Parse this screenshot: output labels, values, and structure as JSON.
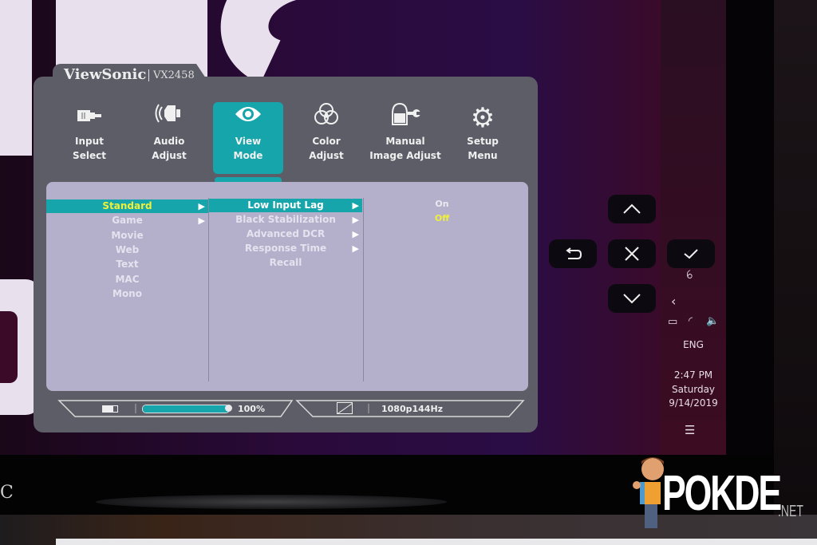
{
  "osd": {
    "brand": "ViewSonic",
    "model": "VX2458",
    "accent_color": "#17a5ac",
    "selected_text_color": "#f0f038",
    "menu": [
      {
        "line1": "Input",
        "line2": "Select",
        "icon": "input-connector-icon",
        "glyph": "▬"
      },
      {
        "line1": "Audio",
        "line2": "Adjust",
        "icon": "speaker-icon",
        "glyph": "🔊"
      },
      {
        "line1": "View",
        "line2": "Mode",
        "icon": "eye-icon",
        "glyph": "◉",
        "active": true
      },
      {
        "line1": "Color",
        "line2": "Adjust",
        "icon": "color-circles-icon",
        "glyph": "❀"
      },
      {
        "line1": "Manual",
        "line2": "Image Adjust",
        "icon": "hand-wrench-icon",
        "glyph": "✋"
      },
      {
        "line1": "Setup",
        "line2": "Menu",
        "icon": "gear-icon",
        "glyph": "⚙"
      }
    ],
    "view_modes": [
      "Standard",
      "Game",
      "Movie",
      "Web",
      "Text",
      "MAC",
      "Mono"
    ],
    "standard_submenu": [
      "Low Input Lag",
      "Black Stabilization",
      "Advanced DCR",
      "Response Time",
      "Recall"
    ],
    "low_input_lag_options": [
      "On",
      "Off"
    ],
    "low_input_lag_selected": "Off",
    "status": {
      "battery_icon": "battery-icon",
      "level_percent": 100,
      "level_label": "100%",
      "resolution_icon": "aspect-ratio-icon",
      "resolution": "1080p144Hz"
    }
  },
  "nav_buttons": {
    "up": "chevron-up",
    "back": "return",
    "close": "close",
    "confirm": "checkmark",
    "down": "chevron-down"
  },
  "taskbar": {
    "language": "ENG",
    "time": "2:47 PM",
    "day": "Saturday",
    "date": "9/14/2019"
  },
  "watermark": {
    "text": "POKDE",
    "suffix": ".NET"
  }
}
